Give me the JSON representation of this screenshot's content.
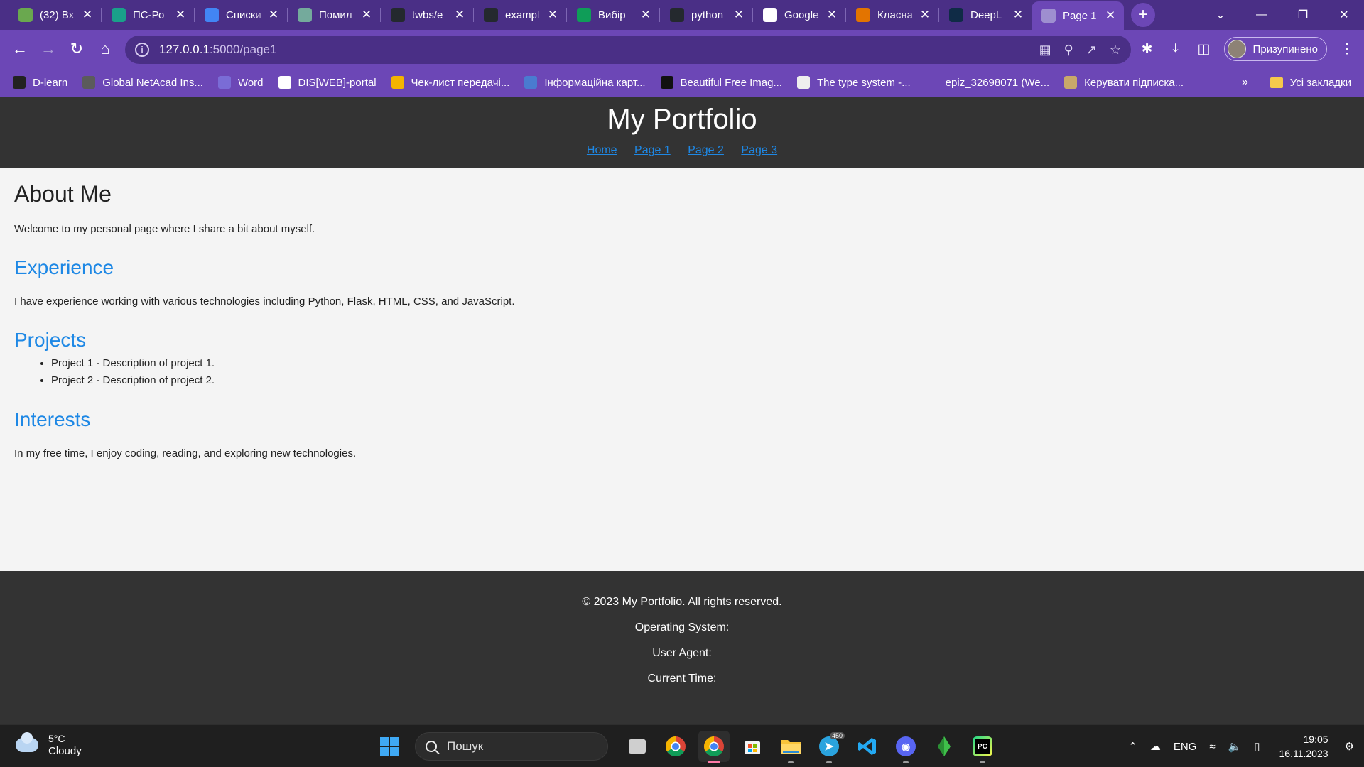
{
  "tabs": [
    {
      "title": "(32) Вх",
      "icon": "mail-icon",
      "color": "#6aa84f"
    },
    {
      "title": "ПС-Ро",
      "icon": "chart-icon",
      "color": "#1aa08a"
    },
    {
      "title": "Списки",
      "icon": "docs-icon",
      "color": "#4285f4"
    },
    {
      "title": "Помил",
      "icon": "chatgpt-icon",
      "color": "#74aa9c"
    },
    {
      "title": "twbs/e",
      "icon": "github-icon",
      "color": "#24292e"
    },
    {
      "title": "exampl",
      "icon": "github-icon",
      "color": "#24292e"
    },
    {
      "title": "Вибір",
      "icon": "sheets-icon",
      "color": "#0f9d58"
    },
    {
      "title": "python",
      "icon": "github-icon",
      "color": "#24292e"
    },
    {
      "title": "Google",
      "icon": "google-icon",
      "color": "#ffffff"
    },
    {
      "title": "Класна",
      "icon": "classroom-icon",
      "color": "#e37400"
    },
    {
      "title": "DeepL",
      "icon": "deepl-icon",
      "color": "#0f2b46"
    },
    {
      "title": "Page 1",
      "icon": "globe-icon",
      "color": "#9e8fd0",
      "active": true
    }
  ],
  "address": {
    "host": "127.0.0.1",
    "path": ":5000/page1"
  },
  "profile": {
    "label": "Призупинено"
  },
  "bookmarks": [
    {
      "label": "D-learn",
      "color": "#222222"
    },
    {
      "label": "Global NetAcad Ins...",
      "color": "#5b5b5b"
    },
    {
      "label": "Word",
      "color": "#7a6cd6"
    },
    {
      "label": "DIS[WEB]-portal",
      "color": "#ffffff"
    },
    {
      "label": "Чек-лист передачі...",
      "color": "#f4b400"
    },
    {
      "label": "Інформаційна карт...",
      "color": "#4a7bd0"
    },
    {
      "label": "Beautiful Free Imag...",
      "color": "#111111"
    },
    {
      "label": "The type system -...",
      "color": "#eeeeee"
    },
    {
      "label": "epiz_32698071 (We...",
      "color": "#6c47b6"
    },
    {
      "label": "Керувати підписка...",
      "color": "#c9a86a"
    }
  ],
  "bookmarks_overflow": "»",
  "bookmarks_all": "Усі закладки",
  "site": {
    "title": "My Portfolio",
    "nav": [
      "Home",
      "Page 1",
      "Page 2",
      "Page 3"
    ],
    "about_heading": "About Me",
    "about_text": "Welcome to my personal page where I share a bit about myself.",
    "experience_heading": "Experience",
    "experience_text": "I have experience working with various technologies including Python, Flask, HTML, CSS, and JavaScript.",
    "projects_heading": "Projects",
    "projects": [
      "Project 1 - Description of project 1.",
      "Project 2 - Description of project 2."
    ],
    "interests_heading": "Interests",
    "interests_text": "In my free time, I enjoy coding, reading, and exploring new technologies.",
    "footer": {
      "copyright": "© 2023 My Portfolio. All rights reserved.",
      "os": "Operating System:",
      "ua": "User Agent:",
      "time": "Current Time:"
    }
  },
  "taskbar": {
    "weather_temp": "5°C",
    "weather_cond": "Cloudy",
    "search_placeholder": "Пошук",
    "telegram_badge": "450",
    "lang": "ENG",
    "time": "19:05",
    "date": "16.11.2023"
  },
  "colors": {
    "chrome_dark": "#4a2f86",
    "chrome": "#6c47b6",
    "site_dark": "#333333",
    "link": "#1e88e5"
  }
}
